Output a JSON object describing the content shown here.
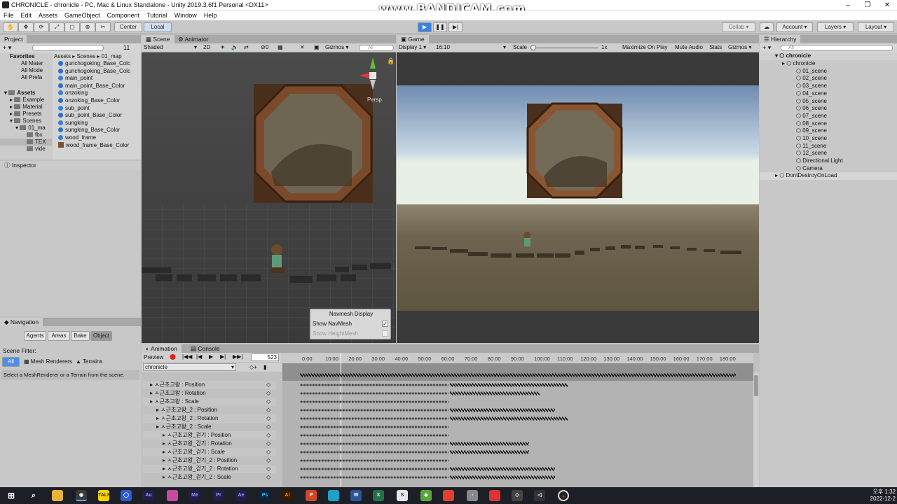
{
  "window": {
    "title": "CHRONICLE - chronicle - PC, Mac & Linux Standalone - Unity 2019.3.6f1 Personal <DX11>",
    "controls": [
      "–",
      "❐",
      "✕"
    ]
  },
  "watermark": "www.BANDICAM.com",
  "menu": [
    "File",
    "Edit",
    "Assets",
    "GameObject",
    "Component",
    "Tutorial",
    "Window",
    "Help"
  ],
  "toolbar": {
    "pivot": "Center",
    "space": "Local",
    "collab": "Collab ▾",
    "account": "Account",
    "layers": "Layers",
    "layout": "Layout"
  },
  "project": {
    "tab": "Project",
    "favorites": "Favorites",
    "fav_items": [
      "All Mater",
      "All Mode",
      "All Prefa"
    ],
    "assets": "Assets",
    "asset_tree": [
      "Example",
      "Material",
      "Presets",
      "Scenes",
      "01_ma",
      "fbx",
      "TEX",
      "vide"
    ],
    "breadcrumb": [
      "Assets",
      "Scenes",
      "01_map"
    ],
    "files": [
      {
        "name": "gunchogoking_Base_Colc",
        "kind": "mat"
      },
      {
        "name": "gunchogoking_Base_Colc",
        "kind": "mat"
      },
      {
        "name": "main_point",
        "kind": "mesh"
      },
      {
        "name": "main_point_Base_Color",
        "kind": "mat"
      },
      {
        "name": "onzoking",
        "kind": "mesh"
      },
      {
        "name": "onzoking_Base_Color",
        "kind": "mat"
      },
      {
        "name": "sub_point",
        "kind": "mesh"
      },
      {
        "name": "sub_point_Base_Color",
        "kind": "mat"
      },
      {
        "name": "sungking",
        "kind": "mesh"
      },
      {
        "name": "sungking_Base_Color",
        "kind": "mat"
      },
      {
        "name": "wood_frame",
        "kind": "mesh"
      },
      {
        "name": "wood_frame_Base_Color",
        "kind": "tex"
      }
    ],
    "count": "11"
  },
  "inspector": {
    "tab": "Inspector"
  },
  "navigation": {
    "tab": "Navigation",
    "tabs": [
      "Agents",
      "Areas",
      "Bake",
      "Object"
    ],
    "scene_filter": "Scene Filter:",
    "filters": [
      "All",
      "Mesh Renderers",
      "Terrains"
    ],
    "hint": "Select a MeshRenderer or a Terrain from the scene."
  },
  "scene": {
    "tabs": [
      "Scene",
      "Animator"
    ],
    "shading": "Shaded",
    "mode2d": "2D",
    "fx_count": "0",
    "gizmos": "Gizmos",
    "search": "All",
    "persp": "Persp",
    "navmesh": {
      "title": "Navmesh Display",
      "show_navmesh": "Show NavMesh",
      "show_heightmesh": "Show HeightMesh"
    }
  },
  "game": {
    "tab": "Game",
    "display": "Display 1",
    "aspect": "16:10",
    "scale_label": "Scale",
    "scale_value": "1x",
    "options": [
      "Maximize On Play",
      "Mute Audio",
      "Stats",
      "Gizmos"
    ]
  },
  "hierarchy": {
    "tab": "Hierarchy",
    "search": "All",
    "root": "chronicle",
    "items": [
      "chronicle",
      "01_scene",
      "02_scene",
      "03_scene",
      "04_scene",
      "05_scene",
      "06_scene",
      "07_scene",
      "08_scene",
      "09_scene",
      "10_scene",
      "11_scene",
      "12_scene",
      "Directional Light",
      "Camera"
    ],
    "dont_destroy": "DontDestroyOnLoad"
  },
  "animation": {
    "tabs": [
      "Animation",
      "Console"
    ],
    "preview": "Preview",
    "frame": "523",
    "clip": "chronicle",
    "ruler": [
      "0:00",
      "10:00",
      "20:00",
      "30:00",
      "40:00",
      "50:00",
      "60:00",
      "70:00",
      "80:00",
      "90:00",
      "100:00",
      "110:00",
      "120:00",
      "130:00",
      "140:00",
      "150:00",
      "160:00",
      "170:00",
      "180:00"
    ],
    "properties": [
      {
        "name": "ㅅ근초고왕 : Position",
        "indent": 0,
        "end": 810
      },
      {
        "name": "ㅅ근초고왕 : Rotation",
        "indent": 0,
        "end": 770
      },
      {
        "name": "ㅅ근초고왕 : Scale",
        "indent": 0,
        "end": 640
      },
      {
        "name": "ㅅ근초고왕_2 : Position",
        "indent": 1,
        "end": 792
      },
      {
        "name": "ㅅ근초고왕_2 : Rotation",
        "indent": 1,
        "end": 810
      },
      {
        "name": "ㅅ근초고왕_2 : Scale",
        "indent": 1,
        "end": 640
      },
      {
        "name": "ㅅ근초고왕_걷기 : Position",
        "indent": 2,
        "end": 640
      },
      {
        "name": "ㅅ근초고왕_걷기 : Rotation",
        "indent": 2,
        "end": 755
      },
      {
        "name": "ㅅ근초고왕_걷기 : Scale",
        "indent": 2,
        "end": 755
      },
      {
        "name": "ㅅ근초고왕_걷기_2 : Position",
        "indent": 2,
        "end": 640
      },
      {
        "name": "ㅅ근초고왕_걷기_2 : Rotation",
        "indent": 2,
        "end": 792
      },
      {
        "name": "ㅅ근초고왕_걷기_2 : Scale",
        "indent": 2,
        "end": 792
      }
    ]
  },
  "taskbar": {
    "apps": [
      "Au",
      "Me",
      "Pr",
      "Ae",
      "Ps",
      "Ai",
      "W",
      "X"
    ],
    "time": "오후 1:32",
    "date": "2022-12-2"
  }
}
